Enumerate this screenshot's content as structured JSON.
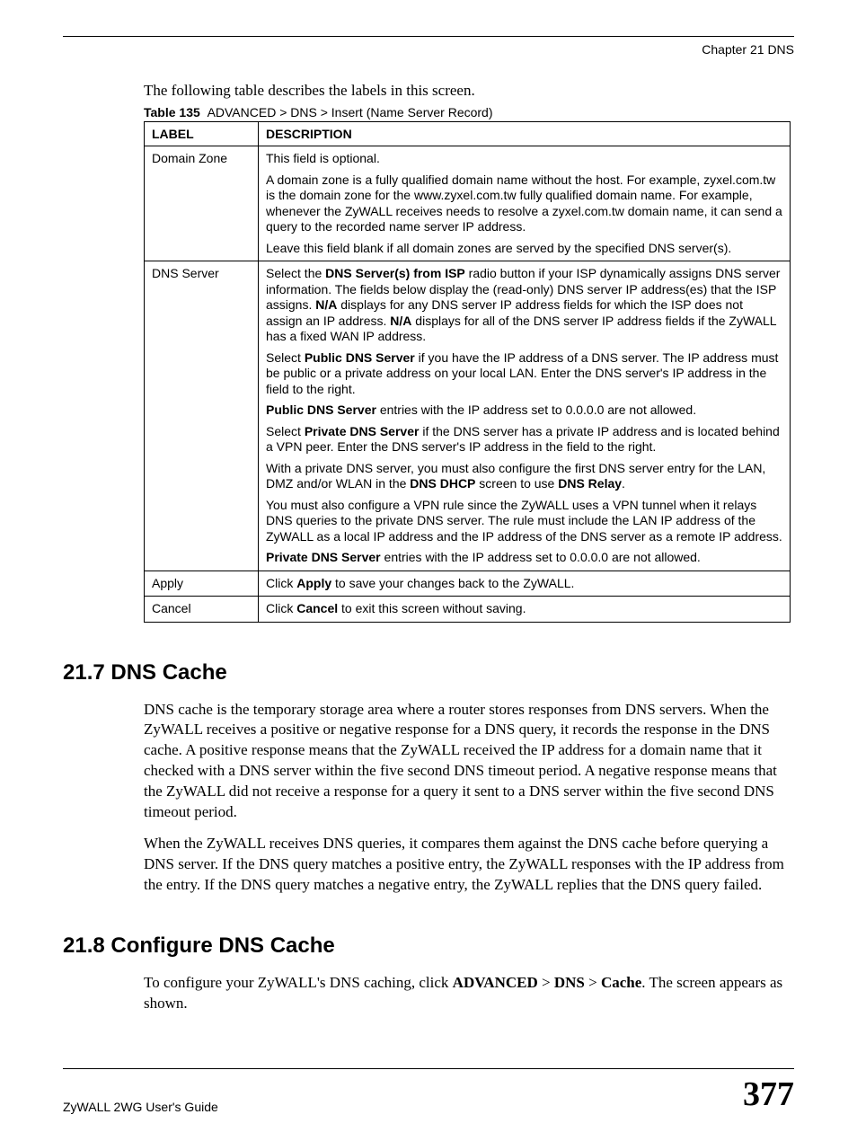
{
  "header": {
    "chapter": "Chapter 21 DNS"
  },
  "intro": "The following table describes the labels in this screen.",
  "table_caption": {
    "num": "Table 135",
    "title": "ADVANCED > DNS > Insert (Name Server Record)"
  },
  "table": {
    "headers": {
      "label": "LABEL",
      "description": "DESCRIPTION"
    },
    "rows": [
      {
        "label": "Domain Zone",
        "desc": [
          {
            "segments": [
              {
                "t": "This field is optional."
              }
            ]
          },
          {
            "segments": [
              {
                "t": "A domain zone is a fully qualified domain name without the host. For example, zyxel.com.tw is the domain zone for the www.zyxel.com.tw fully qualified domain name. For example, whenever the ZyWALL receives needs to resolve a zyxel.com.tw domain name, it can send a query to the recorded name server IP address."
              }
            ]
          },
          {
            "segments": [
              {
                "t": "Leave this field blank if all domain zones are served by the specified DNS server(s)."
              }
            ]
          }
        ]
      },
      {
        "label": "DNS Server",
        "desc": [
          {
            "segments": [
              {
                "t": "Select the "
              },
              {
                "t": "DNS Server(s) from ISP",
                "b": true
              },
              {
                "t": " radio button if your ISP dynamically assigns DNS server information. The fields below display the (read-only) DNS server IP address(es) that the ISP assigns. "
              },
              {
                "t": "N/A",
                "b": true
              },
              {
                "t": " displays for any DNS server IP address fields for which the ISP does not assign an IP address. "
              },
              {
                "t": "N/A",
                "b": true
              },
              {
                "t": " displays for all of the DNS server IP address fields if the ZyWALL has a fixed WAN IP address."
              }
            ]
          },
          {
            "segments": [
              {
                "t": "Select "
              },
              {
                "t": "Public DNS Server",
                "b": true
              },
              {
                "t": " if you have the IP address of a DNS server. The IP address must be public or a private address on your local LAN. Enter the DNS server's IP address in the field to the right."
              }
            ]
          },
          {
            "segments": [
              {
                "t": "Public DNS Server",
                "b": true
              },
              {
                "t": " entries with the IP address set to 0.0.0.0 are not allowed."
              }
            ]
          },
          {
            "segments": [
              {
                "t": "Select "
              },
              {
                "t": "Private DNS Server",
                "b": true
              },
              {
                "t": " if the DNS server has a private IP address and is located behind a VPN peer. Enter the DNS server's IP address in the field to the right."
              }
            ]
          },
          {
            "segments": [
              {
                "t": "With a private DNS server, you must also configure the first DNS server entry for the LAN, DMZ and/or WLAN in the "
              },
              {
                "t": "DNS DHCP",
                "b": true
              },
              {
                "t": " screen to use "
              },
              {
                "t": "DNS Relay",
                "b": true
              },
              {
                "t": "."
              }
            ]
          },
          {
            "segments": [
              {
                "t": "You must also configure a VPN rule since the ZyWALL uses a VPN tunnel when it relays DNS queries to the private DNS server. The rule must include the LAN IP address of the ZyWALL as a local IP address and the IP address of the DNS server as a remote IP address."
              }
            ]
          },
          {
            "segments": [
              {
                "t": "Private DNS Server",
                "b": true
              },
              {
                "t": " entries with the IP address set to 0.0.0.0 are not allowed."
              }
            ]
          }
        ]
      },
      {
        "label": "Apply",
        "desc": [
          {
            "segments": [
              {
                "t": "Click "
              },
              {
                "t": "Apply",
                "b": true
              },
              {
                "t": " to save your changes back to the ZyWALL."
              }
            ]
          }
        ]
      },
      {
        "label": "Cancel",
        "desc": [
          {
            "segments": [
              {
                "t": "Click "
              },
              {
                "t": "Cancel",
                "b": true
              },
              {
                "t": " to exit this screen without saving."
              }
            ]
          }
        ]
      }
    ]
  },
  "sections": {
    "s1": {
      "heading": "21.7  DNS Cache",
      "paras": [
        "DNS cache is the temporary storage area where a router stores responses from DNS servers. When the ZyWALL receives a positive or negative response for a DNS query, it records the response in the DNS cache. A positive response means that the ZyWALL received the IP address for a domain name that it checked with a DNS server within the five second DNS timeout period. A negative response means that the ZyWALL did not receive a response for a query it sent to a DNS server within the five second DNS timeout period.",
        "When the ZyWALL receives DNS queries, it compares them against the DNS cache before querying a DNS server. If the DNS query matches a positive entry, the ZyWALL responses with the IP address from the entry. If the DNS query matches a negative entry, the ZyWALL replies that the DNS query failed."
      ]
    },
    "s2": {
      "heading": "21.8  Configure DNS Cache",
      "intro": {
        "segments": [
          {
            "t": "To configure your ZyWALL's DNS caching, click "
          },
          {
            "t": "ADVANCED",
            "b": true
          },
          {
            "t": " > "
          },
          {
            "t": "DNS",
            "b": true
          },
          {
            "t": " > "
          },
          {
            "t": "Cache",
            "b": true
          },
          {
            "t": ". The screen appears as shown."
          }
        ]
      }
    }
  },
  "footer": {
    "guide": "ZyWALL 2WG User's Guide",
    "page": "377"
  }
}
